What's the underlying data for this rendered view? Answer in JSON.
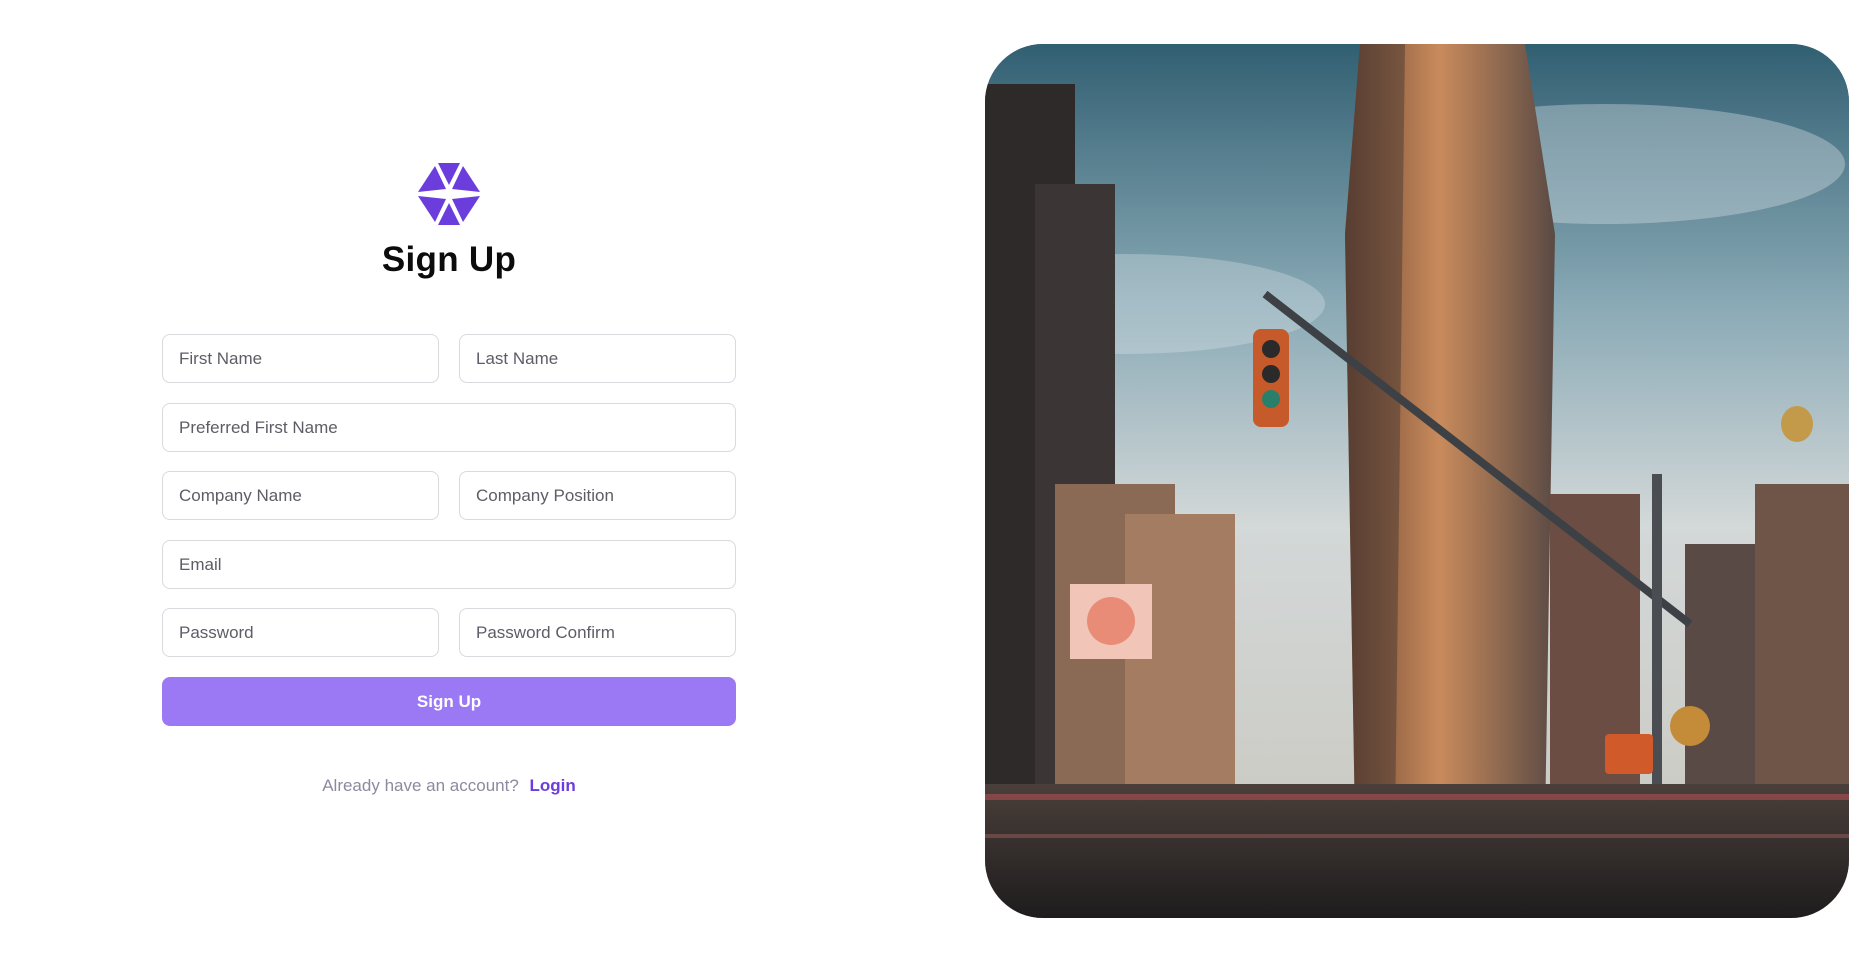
{
  "brand": {
    "logo_icon": "hexagon-triangles-icon",
    "accent_color": "#6b3ddc",
    "button_color": "#9b78f4"
  },
  "form": {
    "title": "Sign Up",
    "fields": {
      "first_name": {
        "placeholder": "First Name",
        "value": ""
      },
      "last_name": {
        "placeholder": "Last Name",
        "value": ""
      },
      "preferred_first_name": {
        "placeholder": "Preferred First Name",
        "value": ""
      },
      "company_name": {
        "placeholder": "Company Name",
        "value": ""
      },
      "company_position": {
        "placeholder": "Company Position",
        "value": ""
      },
      "email": {
        "placeholder": "Email",
        "value": ""
      },
      "password": {
        "placeholder": "Password",
        "value": ""
      },
      "password_confirm": {
        "placeholder": "Password Confirm",
        "value": ""
      }
    },
    "submit_label": "Sign Up"
  },
  "footer": {
    "prompt": "Already have an account?",
    "login_label": "Login"
  },
  "hero_image": {
    "description_icon": "city-street-photo"
  }
}
